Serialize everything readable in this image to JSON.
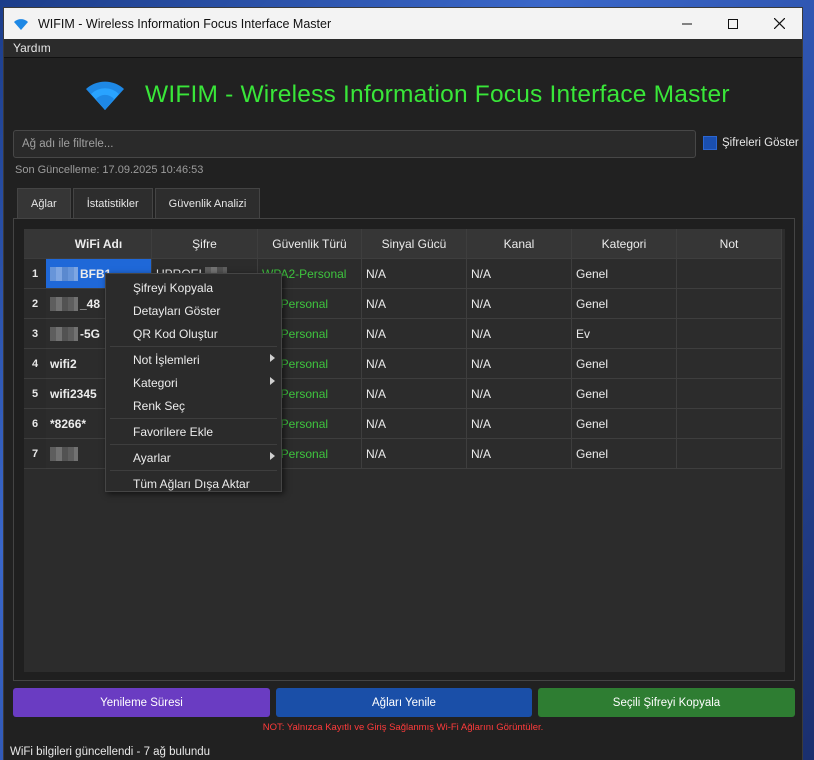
{
  "window": {
    "title": "WIFIM - Wireless Information Focus Interface Master"
  },
  "menu": {
    "items": [
      "Yardım"
    ]
  },
  "header": {
    "title": "WIFIM - Wireless Information Focus Interface Master",
    "title_color": "#39e639"
  },
  "filter": {
    "placeholder": "Ağ adı ile filtrele...",
    "value": ""
  },
  "show_passwords": {
    "label": "Şifreleri Göster",
    "checked": true
  },
  "last_update": "Son Güncelleme: 17.09.2025 10:46:53",
  "tabs": [
    {
      "label": "Ağlar",
      "active": true
    },
    {
      "label": "İstatistikler",
      "active": false
    },
    {
      "label": "Güvenlik Analizi",
      "active": false
    }
  ],
  "table": {
    "columns": [
      "WiFi Adı",
      "Şifre",
      "Güvenlik Türü",
      "Sinyal Gücü",
      "Kanal",
      "Kategori",
      "Not"
    ],
    "rows": [
      {
        "num": "1",
        "name_suffix": "BFB1",
        "password": "UPROEL",
        "security": "WPA2-Personal",
        "signal": "N/A",
        "channel": "N/A",
        "category": "Genel",
        "note": ""
      },
      {
        "num": "2",
        "name_suffix": "_48",
        "password": "",
        "security": "WPA2-Personal",
        "signal": "N/A",
        "channel": "N/A",
        "category": "Genel",
        "note": ""
      },
      {
        "num": "3",
        "name_suffix": "-5G",
        "password": "",
        "security": "WPA2-Personal",
        "signal": "N/A",
        "channel": "N/A",
        "category": "Ev",
        "note": ""
      },
      {
        "num": "4",
        "name": "wifi2",
        "password": "",
        "security": "WPA2-Personal",
        "signal": "N/A",
        "channel": "N/A",
        "category": "Genel",
        "note": ""
      },
      {
        "num": "5",
        "name": "wifi2345",
        "password": "",
        "security": "WPA2-Personal",
        "signal": "N/A",
        "channel": "N/A",
        "category": "Genel",
        "note": ""
      },
      {
        "num": "6",
        "name": "*8266*",
        "password": "",
        "security": "WPA2-Personal",
        "signal": "N/A",
        "channel": "N/A",
        "category": "Genel",
        "note": ""
      },
      {
        "num": "7",
        "name": "",
        "password": "",
        "security": "WPA2-Personal",
        "signal": "N/A",
        "channel": "N/A",
        "category": "Genel",
        "note": ""
      }
    ],
    "security_visible": [
      "A2-Personal",
      "WPA2-Personal"
    ]
  },
  "context_menu": {
    "items": [
      {
        "label": "Şifreyi Kopyala",
        "submenu": false
      },
      {
        "label": "Detayları Göster",
        "submenu": false
      },
      {
        "label": "QR Kod Oluştur",
        "submenu": false
      },
      {
        "label": "Not İşlemleri",
        "submenu": true
      },
      {
        "label": "Kategori",
        "submenu": true
      },
      {
        "label": "Renk Seç",
        "submenu": false
      },
      {
        "label": "Favorilere Ekle",
        "submenu": false
      },
      {
        "label": "Ayarlar",
        "submenu": true
      },
      {
        "label": "Tüm Ağları Dışa Aktar",
        "submenu": false
      }
    ]
  },
  "buttons": {
    "refresh_interval": "Yenileme Süresi",
    "refresh_networks": "Ağları Yenile",
    "copy_selected": "Seçili Şifreyi Kopyala"
  },
  "note": "NOT: Yalnızca Kayıtlı ve Giriş Sağlanmış Wi-Fi Ağlarını Görüntüler.",
  "status": "WiFi bilgileri güncellendi - 7 ağ bulundu",
  "colors": {
    "accent_green": "#39e639",
    "purple": "#6a3cc2",
    "blue": "#1a4fa8",
    "green_button": "#2e7d32",
    "warning": "#ff3b3b"
  }
}
